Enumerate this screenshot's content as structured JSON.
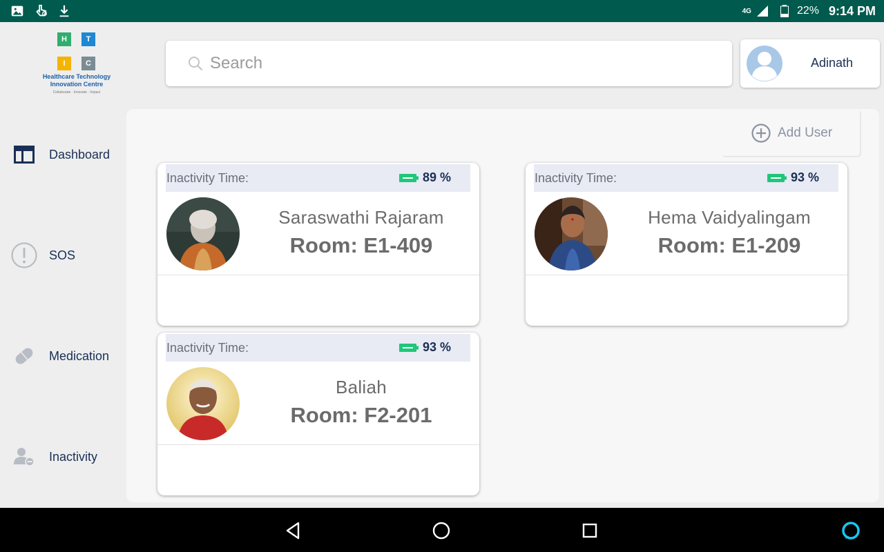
{
  "status_bar": {
    "network": "4G",
    "battery": "22%",
    "time": "9:14 PM"
  },
  "logo": {
    "tiles": [
      "H",
      "T",
      "I",
      "C"
    ],
    "line1": "Healthcare Technology",
    "line2": "Innovation Centre",
    "tagline": "Collaborate · Innovate · Impact"
  },
  "sidebar": {
    "items": [
      {
        "label": "Dashboard",
        "icon": "dashboard-icon"
      },
      {
        "label": "SOS",
        "icon": "alert-icon"
      },
      {
        "label": "Medication",
        "icon": "pill-icon"
      },
      {
        "label": "Inactivity",
        "icon": "inactivity-icon"
      }
    ]
  },
  "search": {
    "placeholder": "Search",
    "value": ""
  },
  "user": {
    "name": "Adinath"
  },
  "main": {
    "add_user_label": "Add User",
    "cards": [
      {
        "inactivity_label": "Inactivity Time:",
        "battery": "89 %",
        "name": "Saraswathi Rajaram",
        "room": "Room: E1-409"
      },
      {
        "inactivity_label": "Inactivity Time:",
        "battery": "93 %",
        "name": "Hema Vaidyalingam",
        "room": "Room: E1-209"
      },
      {
        "inactivity_label": "Inactivity Time:",
        "battery": "93 %",
        "name": "Baliah",
        "room": "Room: F2-201"
      }
    ]
  },
  "colors": {
    "status_bar": "#005a4e",
    "accent_text": "#1a2f55",
    "battery_green": "#1fc77a",
    "card_header": "#e8eaf4"
  }
}
